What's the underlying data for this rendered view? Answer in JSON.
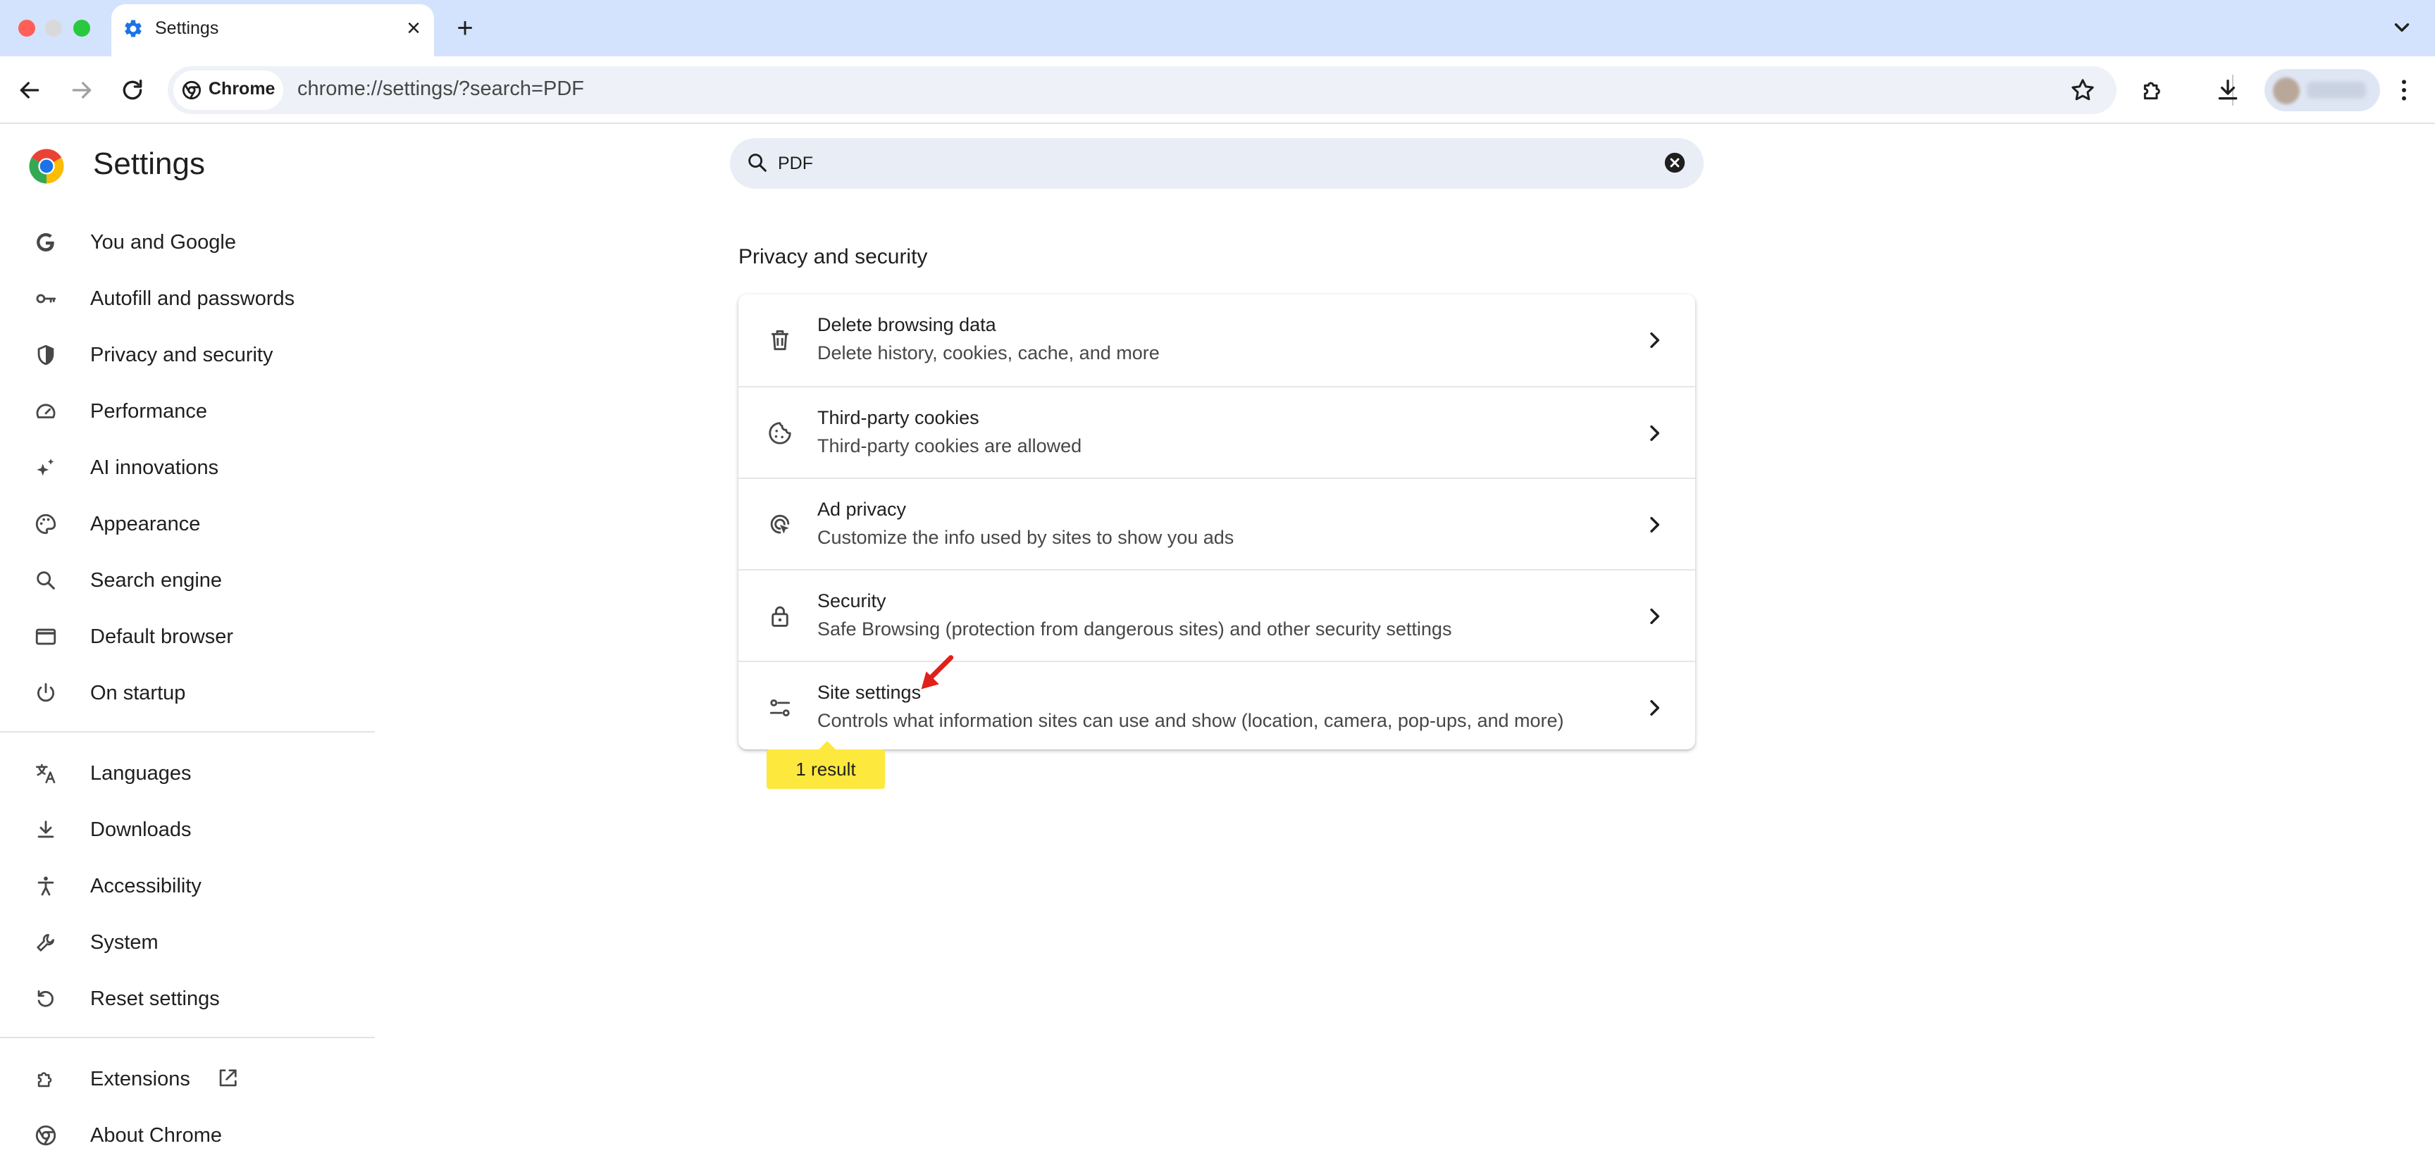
{
  "window": {
    "tab_title": "Settings",
    "traffic_colors": [
      "#ff5f57",
      "#d9d9d9",
      "#28c840"
    ]
  },
  "toolbar": {
    "chip_label": "Chrome",
    "url": "chrome://settings/?search=PDF"
  },
  "page": {
    "title": "Settings",
    "search": {
      "value": "PDF"
    },
    "sidebar": {
      "group1": [
        {
          "label": "You and Google",
          "icon": "google-g-icon"
        },
        {
          "label": "Autofill and passwords",
          "icon": "key-icon"
        },
        {
          "label": "Privacy and security",
          "icon": "shield-icon"
        },
        {
          "label": "Performance",
          "icon": "speedometer-icon"
        },
        {
          "label": "AI innovations",
          "icon": "sparkle-icon"
        },
        {
          "label": "Appearance",
          "icon": "palette-icon"
        },
        {
          "label": "Search engine",
          "icon": "search-icon"
        },
        {
          "label": "Default browser",
          "icon": "browser-window-icon"
        },
        {
          "label": "On startup",
          "icon": "power-icon"
        }
      ],
      "group2": [
        {
          "label": "Languages",
          "icon": "translate-icon"
        },
        {
          "label": "Downloads",
          "icon": "download-icon"
        },
        {
          "label": "Accessibility",
          "icon": "accessibility-icon"
        },
        {
          "label": "System",
          "icon": "wrench-icon"
        },
        {
          "label": "Reset settings",
          "icon": "reset-icon"
        }
      ],
      "group3": [
        {
          "label": "Extensions",
          "icon": "puzzle-icon"
        },
        {
          "label": "About Chrome",
          "icon": "chrome-icon"
        }
      ]
    },
    "section_title": "Privacy and security",
    "rows": [
      {
        "title": "Delete browsing data",
        "subtitle": "Delete history, cookies, cache, and more",
        "icon": "trash-icon"
      },
      {
        "title": "Third-party cookies",
        "subtitle": "Third-party cookies are allowed",
        "icon": "cookie-icon"
      },
      {
        "title": "Ad privacy",
        "subtitle": "Customize the info used by sites to show you ads",
        "icon": "ad-privacy-icon"
      },
      {
        "title": "Security",
        "subtitle": "Safe Browsing (protection from dangerous sites) and other security settings",
        "icon": "lock-icon"
      },
      {
        "title": "Site settings",
        "subtitle": "Controls what information sites can use and show (location, camera, pop-ups, and more)",
        "icon": "tune-icon"
      }
    ],
    "result_bubble": "1 result"
  },
  "colors": {
    "tabstrip": "#d3e3fd",
    "omnibox": "#eef1f8",
    "highlight": "#fde83e",
    "annotation_arrow": "#e0201a"
  }
}
